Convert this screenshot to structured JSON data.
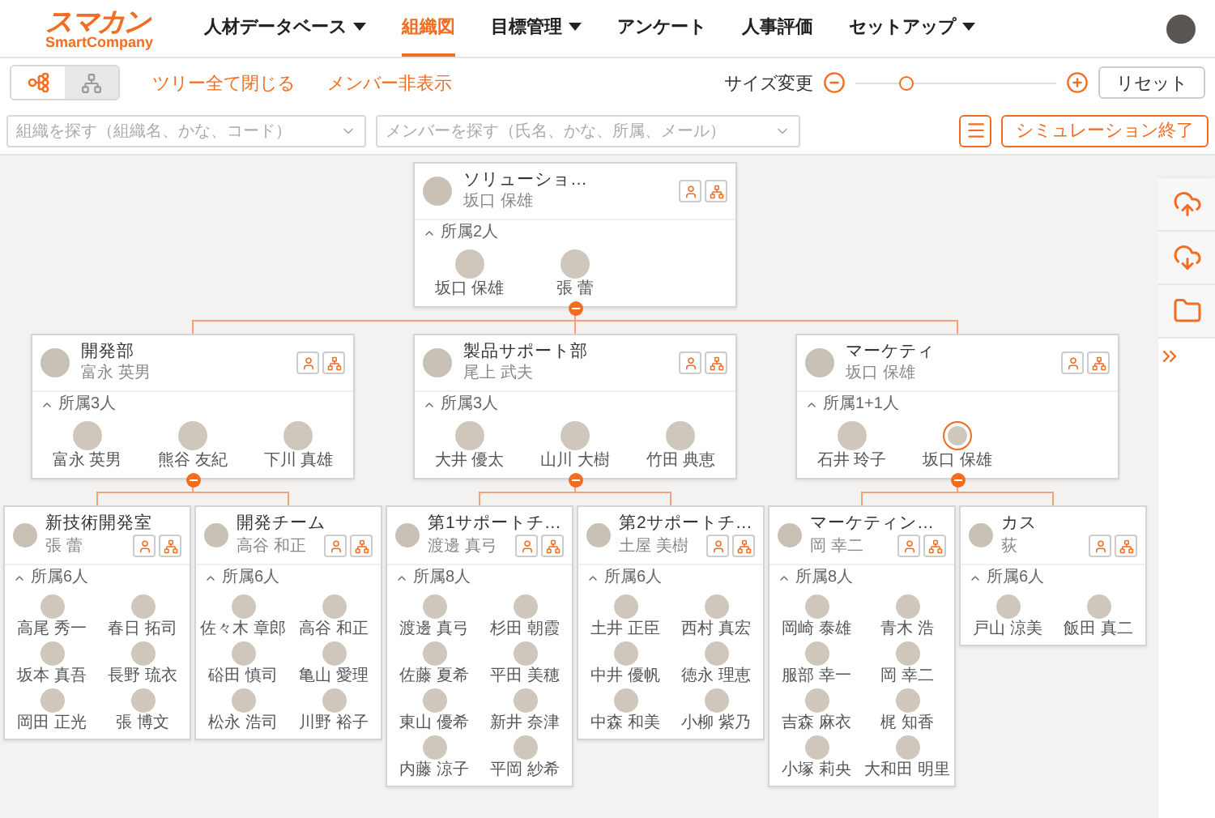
{
  "logo": {
    "name": "スマカン",
    "subtitle": "SmartCompany"
  },
  "nav": [
    {
      "label": "人材データベース",
      "dropdown": true,
      "selected": false
    },
    {
      "label": "組織図",
      "dropdown": false,
      "selected": true
    },
    {
      "label": "目標管理",
      "dropdown": true,
      "selected": false
    },
    {
      "label": "アンケート",
      "dropdown": false,
      "selected": false
    },
    {
      "label": "人事評価",
      "dropdown": false,
      "selected": false
    },
    {
      "label": "セットアップ",
      "dropdown": true,
      "selected": false
    }
  ],
  "toolbar": {
    "views": [
      {
        "kind": "horizontal",
        "selected": true
      },
      {
        "kind": "vertical",
        "selected": false
      }
    ],
    "actions": [
      "ツリー全て閉じる",
      "メンバー非表示"
    ],
    "size_label": "サイズ変更",
    "zoom": {
      "level": 0.25
    },
    "reset": "リセット"
  },
  "search": {
    "org_placeholder": "組織を探す（組織名、かな、コード）",
    "member_placeholder": "メンバーを探す（氏名、かな、所属、メール）"
  },
  "simulation_button": "シミュレーション終了",
  "org": {
    "title": "ソリューショ…",
    "manager": "坂口 保雄",
    "count": "所属2人",
    "members": [
      {
        "name": "坂口 保雄",
        "concurrent": false
      },
      {
        "name": "張 蕾",
        "concurrent": false
      }
    ],
    "children": [
      {
        "title": "開発部",
        "manager": "富永 英男",
        "count": "所属3人",
        "members": [
          {
            "name": "富永 英男",
            "concurrent": false
          },
          {
            "name": "熊谷 友紀",
            "concurrent": false
          },
          {
            "name": "下川 真雄",
            "concurrent": false
          }
        ],
        "children": [
          {
            "title": "新技術開発室",
            "manager": "張 蕾",
            "count": "所属6人",
            "members": [
              {
                "name": "高尾 秀一",
                "concurrent": false
              },
              {
                "name": "春日 拓司",
                "concurrent": false
              },
              {
                "name": "坂本 真吾",
                "concurrent": false
              },
              {
                "name": "長野 琉衣",
                "concurrent": false
              },
              {
                "name": "岡田 正光",
                "concurrent": false
              },
              {
                "name": "張 博文",
                "concurrent": false
              }
            ]
          },
          {
            "title": "開発チーム",
            "manager": "高谷 和正",
            "count": "所属6人",
            "members": [
              {
                "name": "佐々木 章郎",
                "concurrent": false
              },
              {
                "name": "高谷 和正",
                "concurrent": false
              },
              {
                "name": "硲田 慎司",
                "concurrent": false
              },
              {
                "name": "亀山 愛理",
                "concurrent": false
              },
              {
                "name": "松永 浩司",
                "concurrent": false
              },
              {
                "name": "川野 裕子",
                "concurrent": false
              }
            ]
          }
        ]
      },
      {
        "title": "製品サポート部",
        "manager": "尾上 武夫",
        "count": "所属3人",
        "members": [
          {
            "name": "大井 優太",
            "concurrent": false
          },
          {
            "name": "山川 大樹",
            "concurrent": false
          },
          {
            "name": "竹田 典恵",
            "concurrent": false
          }
        ],
        "children": [
          {
            "title": "第1サポートチ…",
            "manager": "渡邊 真弓",
            "count": "所属8人",
            "members": [
              {
                "name": "渡邊 真弓",
                "concurrent": false
              },
              {
                "name": "杉田 朝霞",
                "concurrent": false
              },
              {
                "name": "佐藤 夏希",
                "concurrent": false
              },
              {
                "name": "平田 美穂",
                "concurrent": false
              },
              {
                "name": "東山 優希",
                "concurrent": false
              },
              {
                "name": "新井 奈津",
                "concurrent": false
              },
              {
                "name": "内藤 涼子",
                "concurrent": false
              },
              {
                "name": "平岡 紗希",
                "concurrent": false
              }
            ]
          },
          {
            "title": "第2サポートチ…",
            "manager": "土屋 美樹",
            "count": "所属6人",
            "members": [
              {
                "name": "土井 正臣",
                "concurrent": false
              },
              {
                "name": "西村 真宏",
                "concurrent": false
              },
              {
                "name": "中井 優帆",
                "concurrent": false
              },
              {
                "name": "徳永 理恵",
                "concurrent": false
              },
              {
                "name": "中森 和美",
                "concurrent": false
              },
              {
                "name": "小柳 紫乃",
                "concurrent": false
              }
            ]
          }
        ]
      },
      {
        "title": "マーケティ",
        "manager": "坂口 保雄",
        "count": "所属1+1人",
        "members": [
          {
            "name": "石井 玲子",
            "concurrent": false
          },
          {
            "name": "坂口 保雄",
            "concurrent": true
          }
        ],
        "children": [
          {
            "title": "マーケティン…",
            "manager": "岡 幸二",
            "count": "所属8人",
            "members": [
              {
                "name": "岡崎 泰雄",
                "concurrent": false
              },
              {
                "name": "青木 浩",
                "concurrent": false
              },
              {
                "name": "服部 幸一",
                "concurrent": false
              },
              {
                "name": "岡 幸二",
                "concurrent": false
              },
              {
                "name": "吉森 麻衣",
                "concurrent": false
              },
              {
                "name": "梶 知香",
                "concurrent": false
              },
              {
                "name": "小塚 莉央",
                "concurrent": false
              },
              {
                "name": "大和田 明里",
                "concurrent": false
              }
            ]
          },
          {
            "title": "カス",
            "manager": "荻",
            "count": "所属6人",
            "members": [
              {
                "name": "戸山 涼美",
                "concurrent": false
              },
              {
                "name": "飯田 真二",
                "concurrent": false
              }
            ]
          }
        ]
      }
    ]
  }
}
